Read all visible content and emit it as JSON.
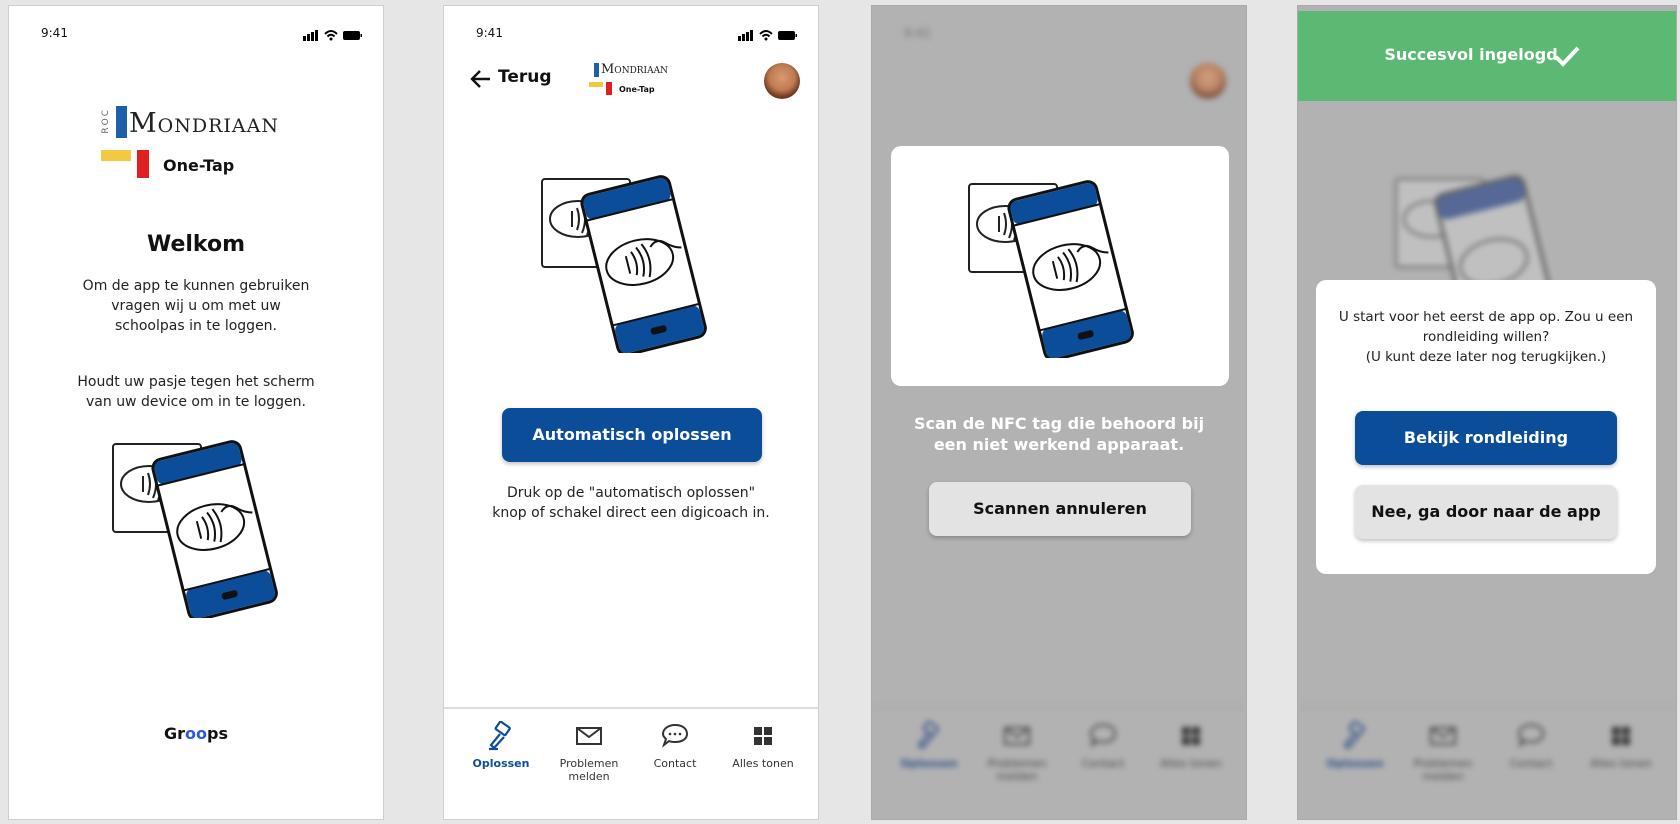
{
  "status": {
    "time": "9:41"
  },
  "logo": {
    "roc": "ROC",
    "brand": "Mondriaan",
    "product": "One-Tap"
  },
  "s1": {
    "title": "Welkom",
    "text1": [
      "Om de app te kunnen gebruiken",
      "vragen wij u om met uw",
      "schoolpas in te loggen."
    ],
    "text2": [
      "Houdt uw pasje tegen het scherm",
      "van uw device om in te loggen."
    ],
    "footer_brand": {
      "part1": "Gr",
      "part2": "oo",
      "part3": "ps"
    }
  },
  "s2": {
    "back_label": "Terug",
    "button": "Automatisch oplossen",
    "hint": [
      "Druk op de \"automatisch oplossen\"",
      "knop of schakel direct een digicoach in."
    ]
  },
  "tabs": [
    {
      "label": "Oplossen",
      "icon": "hammer-icon"
    },
    {
      "label": "Problemen melden",
      "icon": "mail-icon"
    },
    {
      "label": "Contact",
      "icon": "chat-icon"
    },
    {
      "label": "Alles tonen",
      "icon": "grid-icon"
    }
  ],
  "s3": {
    "scan_text": [
      "Scan de NFC tag die behoord bij",
      "een niet werkend apparaat."
    ],
    "cancel_button": "Scannen annuleren"
  },
  "s4": {
    "banner": "Succesvol ingelogd",
    "dialog_text": [
      "U start voor het eerst de app op. Zou u een",
      "rondleiding willen?",
      "(U kunt deze later nog terugkijken.)"
    ],
    "primary_button": "Bekijk rondleiding",
    "secondary_button": "Nee, ga door naar de app"
  },
  "colors": {
    "primary": "#0b4d99",
    "success": "#5cb974",
    "yellow": "#f5c842",
    "red": "#e02020"
  }
}
